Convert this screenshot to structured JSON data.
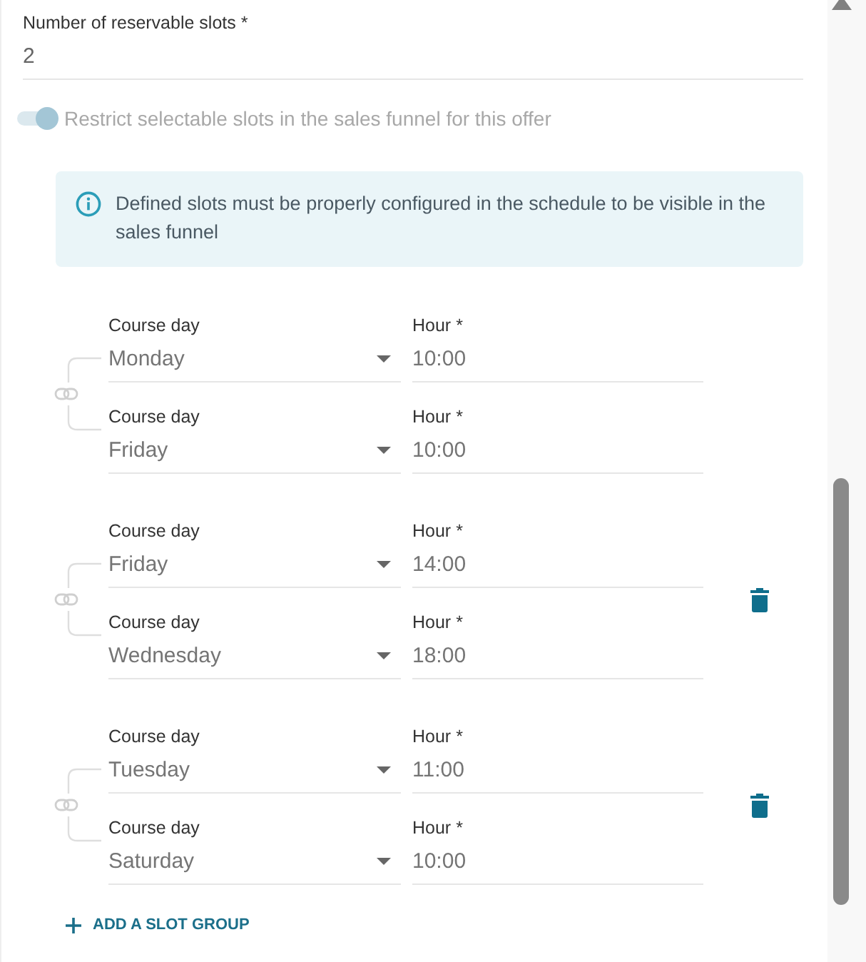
{
  "reservable_slots": {
    "label": "Number of reservable slots *",
    "value": "2"
  },
  "restrict_toggle": {
    "label": "Restrict selectable slots in the sales funnel for this offer",
    "on": true,
    "disabled": true
  },
  "info_notice": {
    "text": "Defined slots must be properly configured in the schedule to be visible in the sales funnel"
  },
  "slot_groups": [
    {
      "removable": false,
      "slots": [
        {
          "day_label": "Course day",
          "day": "Monday",
          "hour_label": "Hour *",
          "hour": "10:00"
        },
        {
          "day_label": "Course day",
          "day": "Friday",
          "hour_label": "Hour *",
          "hour": "10:00"
        }
      ]
    },
    {
      "removable": true,
      "slots": [
        {
          "day_label": "Course day",
          "day": "Friday",
          "hour_label": "Hour *",
          "hour": "14:00"
        },
        {
          "day_label": "Course day",
          "day": "Wednesday",
          "hour_label": "Hour *",
          "hour": "18:00"
        }
      ]
    },
    {
      "removable": true,
      "slots": [
        {
          "day_label": "Course day",
          "day": "Tuesday",
          "hour_label": "Hour *",
          "hour": "11:00"
        },
        {
          "day_label": "Course day",
          "day": "Saturday",
          "hour_label": "Hour *",
          "hour": "10:00"
        }
      ]
    }
  ],
  "add_button": {
    "label": "ADD A SLOT GROUP"
  }
}
